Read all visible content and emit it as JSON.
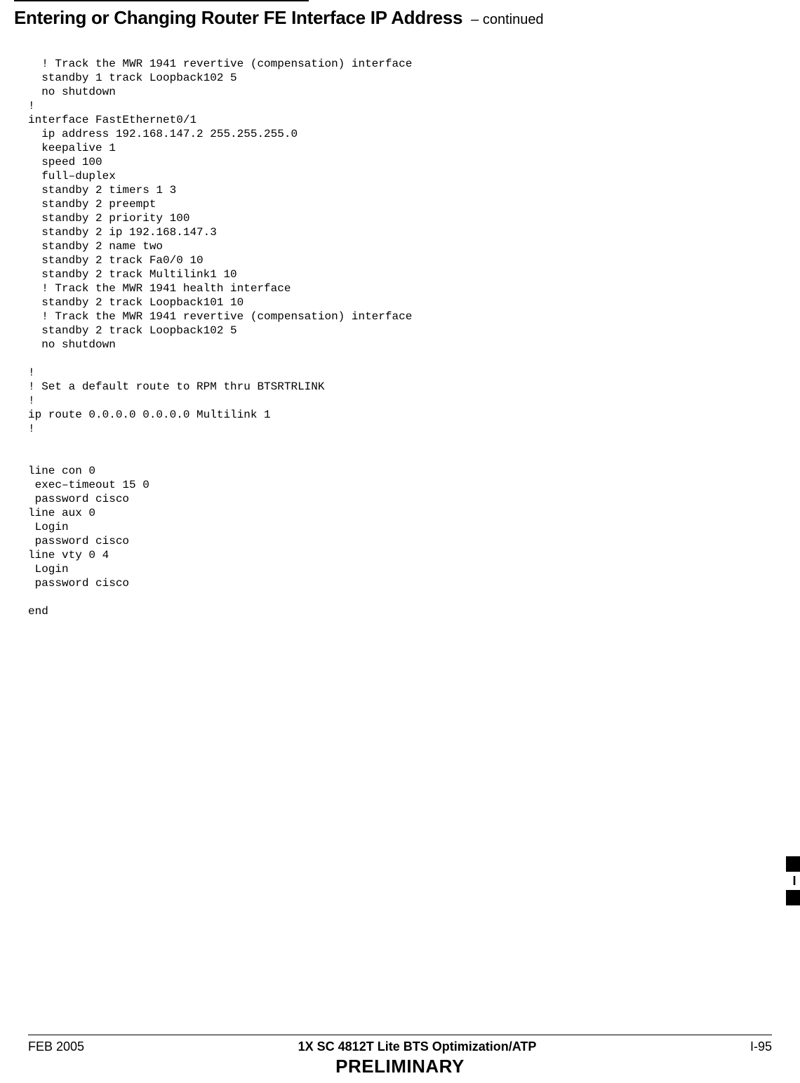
{
  "header": {
    "title": "Entering or Changing Router FE Interface IP Address",
    "continued": " – continued"
  },
  "code": "  ! Track the MWR 1941 revertive (compensation) interface\n  standby 1 track Loopback102 5\n  no shutdown\n!\ninterface FastEthernet0/1\n  ip address 192.168.147.2 255.255.255.0\n  keepalive 1\n  speed 100\n  full–duplex\n  standby 2 timers 1 3\n  standby 2 preempt\n  standby 2 priority 100\n  standby 2 ip 192.168.147.3\n  standby 2 name two\n  standby 2 track Fa0/0 10\n  standby 2 track Multilink1 10\n  ! Track the MWR 1941 health interface\n  standby 2 track Loopback101 10\n  ! Track the MWR 1941 revertive (compensation) interface\n  standby 2 track Loopback102 5\n  no shutdown\n\n!\n! Set a default route to RPM thru BTSRTRLINK\n!\nip route 0.0.0.0 0.0.0.0 Multilink 1\n!\n\n\nline con 0\n exec–timeout 15 0\n password cisco\nline aux 0\n Login\n password cisco\nline vty 0 4\n Login\n password cisco\n\nend",
  "side_tab": "I",
  "footer": {
    "left": "FEB 2005",
    "center": "1X SC 4812T Lite BTS Optimization/ATP",
    "right": "I-95",
    "preliminary": "PRELIMINARY"
  }
}
